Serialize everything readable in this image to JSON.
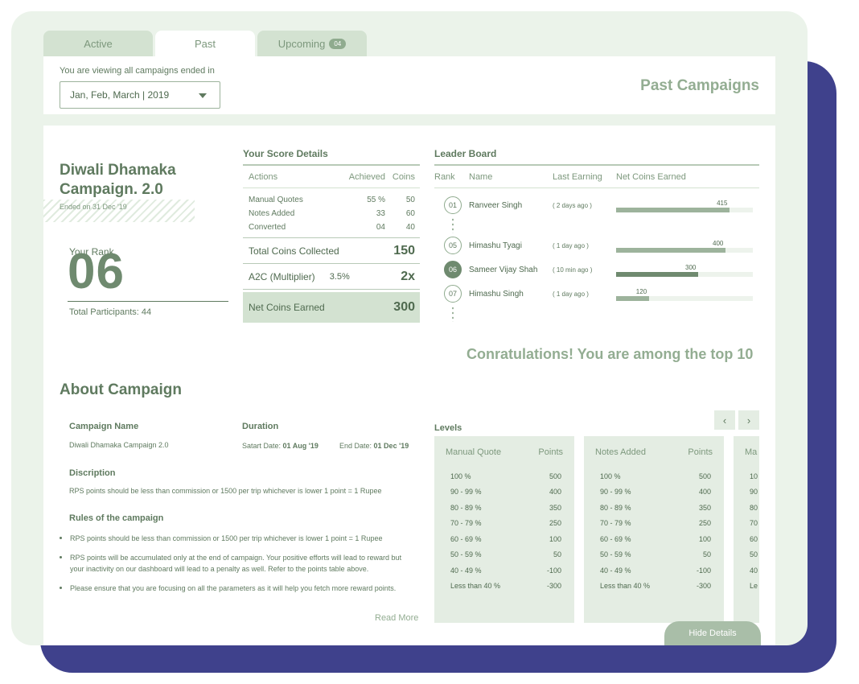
{
  "tabs": {
    "active_label": "Active",
    "past_label": "Past",
    "upcoming_label": "Upcoming",
    "upcoming_badge": "04"
  },
  "filter": {
    "label": "You are viewing all campaigns ended in",
    "selected": "Jan, Feb, March  |  2019"
  },
  "page_title": "Past Campaigns",
  "campaign": {
    "title_line1": "Diwali Dhamaka",
    "title_line2": "Campaign. 2.0",
    "ended_on": "Ended on 31 Dec '19",
    "rank_label": "Your Rank",
    "rank": "06",
    "participants": "Total Participants: 44"
  },
  "score": {
    "title": "Your Score Details",
    "headers": [
      "Actions",
      "Achieved",
      "Coins"
    ],
    "rows": [
      {
        "action": "Manual Quotes",
        "achieved": "55 %",
        "coins": "50"
      },
      {
        "action": "Notes Added",
        "achieved": "33",
        "coins": "60"
      },
      {
        "action": "Converted",
        "achieved": "04",
        "coins": "40"
      }
    ],
    "total_label": "Total Coins Collected",
    "total_value": "150",
    "multiplier_label": "A2C (Multiplier)",
    "multiplier_pct": "3.5%",
    "multiplier_value": "2x",
    "net_label": "Net Coins Earned",
    "net_value": "300"
  },
  "leaderboard": {
    "title": "Leader Board",
    "headers": [
      "Rank",
      "Name",
      "Last Earning",
      "Net Coins Earned"
    ],
    "max_coins": 500,
    "rows": [
      {
        "rank": "01",
        "name": "Ranveer Singh",
        "last": "( 2 days ago )",
        "coins": 415,
        "coins_label": "415",
        "me": false
      },
      {
        "rank": "05",
        "name": "Himashu Tyagi",
        "last": "( 1 day ago )",
        "coins": 400,
        "coins_label": "400",
        "me": false
      },
      {
        "rank": "06",
        "name": "Sameer Vijay Shah",
        "last": "( 10 min ago )",
        "coins": 300,
        "coins_label": "300",
        "me": true
      },
      {
        "rank": "07",
        "name": "Himashu Singh",
        "last": "( 1 day ago )",
        "coins": 120,
        "coins_label": "120",
        "me": false
      }
    ],
    "congrats": "Conratulations! You are among the top 10"
  },
  "about": {
    "title": "About Campaign",
    "name_label": "Campaign Name",
    "name_value": "Diwali Dhamaka Campaign 2.0",
    "duration_label": "Duration",
    "start_label": "Satart Date:",
    "start_value": "01 Aug '19",
    "end_label": "End Date:",
    "end_value": "01 Dec '19",
    "description_label": "Discription",
    "description": "RPS points should be less than commission or 1500 per trip whichever is lower 1 point = 1 Rupee",
    "rules_label": "Rules of the campaign",
    "rules": [
      "RPS points should be less than commission or 1500 per trip whichever is lower 1 point = 1 Rupee",
      "RPS points will be accumulated only at the end of campaign. Your positive efforts will lead to reward but your inactivity on our dashboard will lead to a penalty as well. Refer to the points table above.",
      "Please ensure that you are focusing on all the parameters as it will help you fetch more reward points."
    ],
    "read_more": "Read More"
  },
  "levels": {
    "title": "Levels",
    "prev_glyph": "‹",
    "next_glyph": "›",
    "cards": [
      {
        "name": "Manual Quote",
        "points_label": "Points",
        "rows": [
          [
            "100 %",
            "500"
          ],
          [
            "90 - 99 %",
            "400"
          ],
          [
            "80 - 89 %",
            "350"
          ],
          [
            "70 - 79 %",
            "250"
          ],
          [
            "60 - 69 %",
            "100"
          ],
          [
            "50 - 59 %",
            "50"
          ],
          [
            "40 - 49 %",
            "-100"
          ],
          [
            "Less than 40 %",
            "-300"
          ]
        ]
      },
      {
        "name": "Notes Added",
        "points_label": "Points",
        "rows": [
          [
            "100 %",
            "500"
          ],
          [
            "90 - 99 %",
            "400"
          ],
          [
            "80 - 89 %",
            "350"
          ],
          [
            "70 - 79 %",
            "250"
          ],
          [
            "60 - 69 %",
            "100"
          ],
          [
            "50 - 59 %",
            "50"
          ],
          [
            "40 - 49 %",
            "-100"
          ],
          [
            "Less than 40 %",
            "-300"
          ]
        ]
      },
      {
        "name": "Ma",
        "points_label": "",
        "rows": [
          [
            "10",
            ""
          ],
          [
            "90",
            ""
          ],
          [
            "80",
            ""
          ],
          [
            "70",
            ""
          ],
          [
            "60",
            ""
          ],
          [
            "50",
            ""
          ],
          [
            "40",
            ""
          ],
          [
            "Le",
            ""
          ]
        ]
      }
    ]
  },
  "hide_details": "Hide Details"
}
